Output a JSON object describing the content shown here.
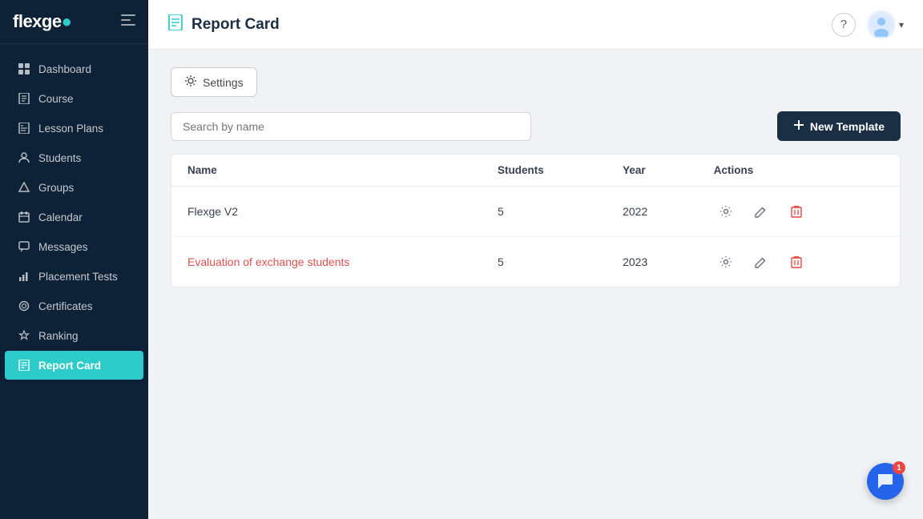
{
  "app": {
    "name": "flexge",
    "logo_dot": "·"
  },
  "sidebar": {
    "collapse_icon": "☰",
    "items": [
      {
        "id": "dashboard",
        "label": "Dashboard",
        "icon": "⊞",
        "active": false
      },
      {
        "id": "course",
        "label": "Course",
        "icon": "📖",
        "active": false
      },
      {
        "id": "lesson-plans",
        "label": "Lesson Plans",
        "icon": "📋",
        "active": false
      },
      {
        "id": "students",
        "label": "Students",
        "icon": "👤",
        "active": false
      },
      {
        "id": "groups",
        "label": "Groups",
        "icon": "◇",
        "active": false
      },
      {
        "id": "calendar",
        "label": "Calendar",
        "icon": "📅",
        "active": false
      },
      {
        "id": "messages",
        "label": "Messages",
        "icon": "💬",
        "active": false
      },
      {
        "id": "placement-tests",
        "label": "Placement Tests",
        "icon": "📊",
        "active": false
      },
      {
        "id": "certificates",
        "label": "Certificates",
        "icon": "🎖",
        "active": false
      },
      {
        "id": "ranking",
        "label": "Ranking",
        "icon": "🏆",
        "active": false
      },
      {
        "id": "report-card",
        "label": "Report Card",
        "icon": "📄",
        "active": true
      }
    ]
  },
  "header": {
    "icon": "📄",
    "title": "Report Card",
    "help_label": "?",
    "avatar_alt": "User avatar"
  },
  "content": {
    "settings_button": "Settings",
    "search_placeholder": "Search by name",
    "new_template_button": "New Template",
    "table": {
      "columns": [
        "Name",
        "Students",
        "Year",
        "Actions"
      ],
      "rows": [
        {
          "name": "Flexge V2",
          "students": "5",
          "year": "2022",
          "link": false
        },
        {
          "name": "Evaluation of exchange students",
          "students": "5",
          "year": "2023",
          "link": true
        }
      ]
    }
  },
  "chat": {
    "badge_count": "1"
  },
  "colors": {
    "sidebar_bg": "#0d2137",
    "active_item": "#2ecbcb",
    "header_bg": "#ffffff",
    "accent_blue": "#1a2e44",
    "link_red": "#e05050",
    "delete_red": "#ef4444"
  }
}
